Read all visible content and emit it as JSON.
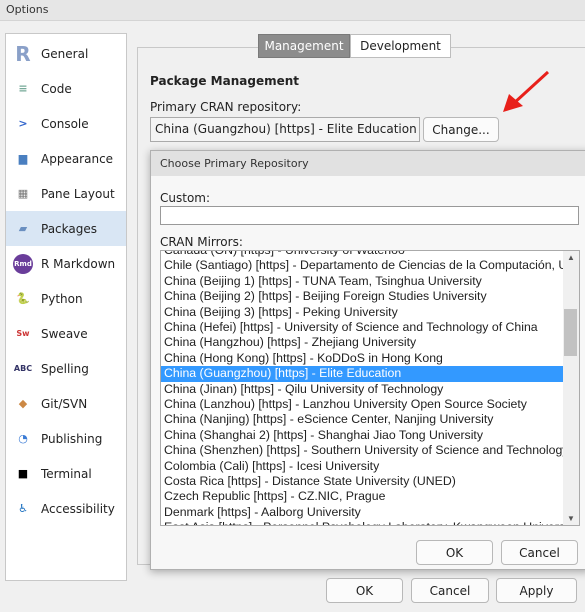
{
  "window": {
    "title": "Options"
  },
  "sidebar": {
    "items": [
      {
        "label": "General",
        "icon": "r-logo-icon"
      },
      {
        "label": "Code",
        "icon": "code-icon"
      },
      {
        "label": "Console",
        "icon": "console-icon"
      },
      {
        "label": "Appearance",
        "icon": "paint-bucket-icon"
      },
      {
        "label": "Pane Layout",
        "icon": "pane-layout-icon"
      },
      {
        "label": "Packages",
        "icon": "package-icon",
        "selected": true
      },
      {
        "label": "R Markdown",
        "icon": "rmd-icon"
      },
      {
        "label": "Python",
        "icon": "python-icon"
      },
      {
        "label": "Sweave",
        "icon": "sweave-icon"
      },
      {
        "label": "Spelling",
        "icon": "spelling-icon"
      },
      {
        "label": "Git/SVN",
        "icon": "git-icon"
      },
      {
        "label": "Publishing",
        "icon": "publishing-icon"
      },
      {
        "label": "Terminal",
        "icon": "terminal-icon"
      },
      {
        "label": "Accessibility",
        "icon": "accessibility-icon"
      }
    ]
  },
  "tabs": [
    {
      "label": "Management",
      "selected": true
    },
    {
      "label": "Development"
    }
  ],
  "main": {
    "section_title": "Package Management",
    "repo_label": "Primary CRAN repository:",
    "repo_value": "China (Guangzhou) [https] - Elite Education",
    "change_button": "Change..."
  },
  "dialog": {
    "title": "Choose Primary Repository",
    "custom_label": "Custom:",
    "custom_value": "",
    "mirrors_label": "CRAN Mirrors:",
    "mirrors": [
      "Canada (ON) [https] - University of Waterloo",
      "Chile (Santiago) [https] - Departamento de Ciencias de la Computación, Universidad de Chile",
      "China (Beijing 1) [https] - TUNA Team, Tsinghua University",
      "China (Beijing 2) [https] - Beijing Foreign Studies University",
      "China (Beijing 3) [https] - Peking University",
      "China (Hefei) [https] - University of Science and Technology of China",
      "China (Hangzhou) [https] - Zhejiang University",
      "China (Hong Kong) [https] - KoDDoS in Hong Kong",
      "China (Guangzhou) [https] - Elite Education",
      "China (Jinan) [https] - Qilu University of Technology",
      "China (Lanzhou) [https] - Lanzhou University Open Source Society",
      "China (Nanjing) [https] - eScience Center, Nanjing University",
      "China (Shanghai 2) [https] - Shanghai Jiao Tong University",
      "China (Shenzhen) [https] - Southern University of Science and Technology",
      "Colombia (Cali) [https] - Icesi University",
      "Costa Rica [https] - Distance State University (UNED)",
      "Czech Republic [https] - CZ.NIC, Prague",
      "Denmark [https] - Aalborg University",
      "East Asia [https] - Personnel Psychology Laboratory, Kwangwoon University"
    ],
    "selected_index": 8,
    "ok": "OK",
    "cancel": "Cancel"
  },
  "footer": {
    "ok": "OK",
    "cancel": "Cancel",
    "apply": "Apply"
  },
  "colors": {
    "selection": "#3399ff",
    "active_tab": "#8c8c8c",
    "arrow": "#e8201a"
  }
}
